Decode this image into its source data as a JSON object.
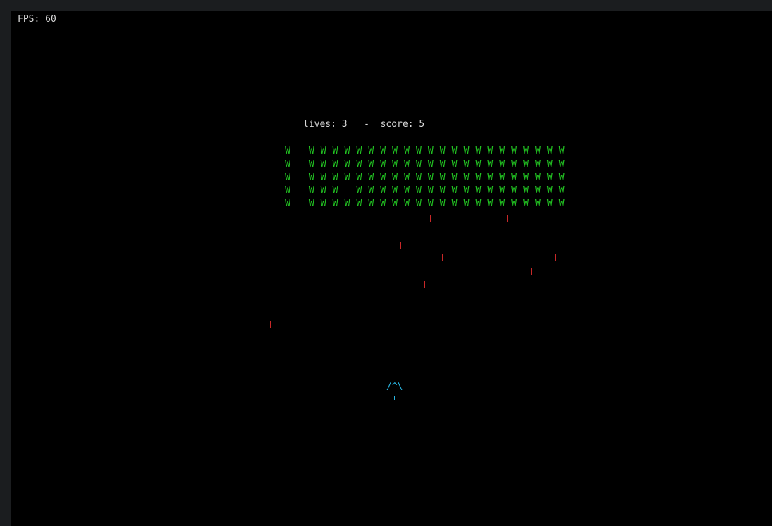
{
  "hud": {
    "fps_label": "FPS: 60",
    "status_text": "lives: 3   -  score: 5",
    "lives": 3,
    "score": 5,
    "fps": 60
  },
  "invaders": {
    "glyph": "W",
    "rows": 5,
    "cols": 24,
    "missing": [
      [
        0,
        1
      ],
      [
        1,
        1
      ],
      [
        2,
        1
      ],
      [
        3,
        1
      ],
      [
        4,
        1
      ],
      [
        3,
        5
      ]
    ],
    "color": "#22c322"
  },
  "enemy_bullets": [
    {
      "col": 594,
      "row": 289
    },
    {
      "col": 703,
      "row": 289
    },
    {
      "col": 653,
      "row": 308
    },
    {
      "col": 552,
      "row": 327
    },
    {
      "col": 611,
      "row": 345
    },
    {
      "col": 771,
      "row": 345
    },
    {
      "col": 737,
      "row": 364
    },
    {
      "col": 586,
      "row": 383
    },
    {
      "col": 367,
      "row": 440
    },
    {
      "col": 670,
      "row": 458
    }
  ],
  "player": {
    "glyph": "/^\\",
    "color": "#28b4e0"
  },
  "colors": {
    "background": "#000000",
    "frame": "#1b1d1f",
    "text": "#d8d8d8",
    "bullet": "#c82828"
  }
}
